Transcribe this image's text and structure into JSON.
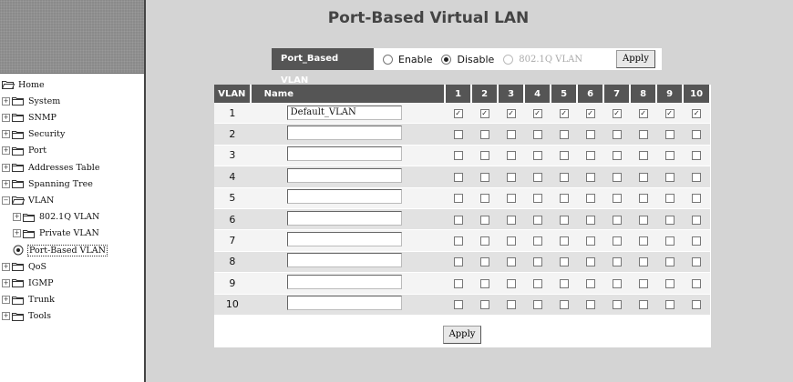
{
  "page": {
    "title": "Port-Based Virtual LAN"
  },
  "mode": {
    "label": "Port_Based VLAN",
    "options": [
      {
        "label": "Enable",
        "selected": false,
        "disabled": false
      },
      {
        "label": "Disable",
        "selected": true,
        "disabled": false
      },
      {
        "label": "802.1Q VLAN",
        "selected": false,
        "disabled": true
      }
    ],
    "apply_label": "Apply"
  },
  "tree": [
    {
      "label": "Home",
      "type": "folder-open",
      "depth": 0,
      "expander": ""
    },
    {
      "label": "System",
      "type": "folder",
      "depth": 0,
      "expander": "+"
    },
    {
      "label": "SNMP",
      "type": "folder",
      "depth": 0,
      "expander": "+"
    },
    {
      "label": "Security",
      "type": "folder",
      "depth": 0,
      "expander": "+"
    },
    {
      "label": "Port",
      "type": "folder",
      "depth": 0,
      "expander": "+"
    },
    {
      "label": "Addresses Table",
      "type": "folder",
      "depth": 0,
      "expander": "+"
    },
    {
      "label": "Spanning Tree",
      "type": "folder",
      "depth": 0,
      "expander": "+"
    },
    {
      "label": "VLAN",
      "type": "folder-open",
      "depth": 0,
      "expander": "-"
    },
    {
      "label": "802.1Q VLAN",
      "type": "folder",
      "depth": 1,
      "expander": "+"
    },
    {
      "label": "Private VLAN",
      "type": "folder",
      "depth": 1,
      "expander": "+"
    },
    {
      "label": "Port-Based VLAN",
      "type": "doc",
      "depth": 1,
      "expander": "",
      "selected": true
    },
    {
      "label": "QoS",
      "type": "folder",
      "depth": 0,
      "expander": "+"
    },
    {
      "label": "IGMP",
      "type": "folder",
      "depth": 0,
      "expander": "+"
    },
    {
      "label": "Trunk",
      "type": "folder",
      "depth": 0,
      "expander": "+"
    },
    {
      "label": "Tools",
      "type": "folder",
      "depth": 0,
      "expander": "+"
    }
  ],
  "table": {
    "headers": {
      "vlan": "VLAN",
      "name": "Name"
    },
    "ports": [
      "1",
      "2",
      "3",
      "4",
      "5",
      "6",
      "7",
      "8",
      "9",
      "10"
    ],
    "rows": [
      {
        "vlan": "1",
        "name": "Default_VLAN",
        "members": [
          true,
          true,
          true,
          true,
          true,
          true,
          true,
          true,
          true,
          true
        ]
      },
      {
        "vlan": "2",
        "name": "",
        "members": [
          false,
          false,
          false,
          false,
          false,
          false,
          false,
          false,
          false,
          false
        ]
      },
      {
        "vlan": "3",
        "name": "",
        "members": [
          false,
          false,
          false,
          false,
          false,
          false,
          false,
          false,
          false,
          false
        ]
      },
      {
        "vlan": "4",
        "name": "",
        "members": [
          false,
          false,
          false,
          false,
          false,
          false,
          false,
          false,
          false,
          false
        ]
      },
      {
        "vlan": "5",
        "name": "",
        "members": [
          false,
          false,
          false,
          false,
          false,
          false,
          false,
          false,
          false,
          false
        ]
      },
      {
        "vlan": "6",
        "name": "",
        "members": [
          false,
          false,
          false,
          false,
          false,
          false,
          false,
          false,
          false,
          false
        ]
      },
      {
        "vlan": "7",
        "name": "",
        "members": [
          false,
          false,
          false,
          false,
          false,
          false,
          false,
          false,
          false,
          false
        ]
      },
      {
        "vlan": "8",
        "name": "",
        "members": [
          false,
          false,
          false,
          false,
          false,
          false,
          false,
          false,
          false,
          false
        ]
      },
      {
        "vlan": "9",
        "name": "",
        "members": [
          false,
          false,
          false,
          false,
          false,
          false,
          false,
          false,
          false,
          false
        ]
      },
      {
        "vlan": "10",
        "name": "",
        "members": [
          false,
          false,
          false,
          false,
          false,
          false,
          false,
          false,
          false,
          false
        ]
      }
    ],
    "apply_label": "Apply"
  },
  "colors": {
    "header_bg": "#555555",
    "row_light": "#f4f4f4",
    "row_dark": "#e2e2e2",
    "page_bg": "#d4d4d4"
  }
}
